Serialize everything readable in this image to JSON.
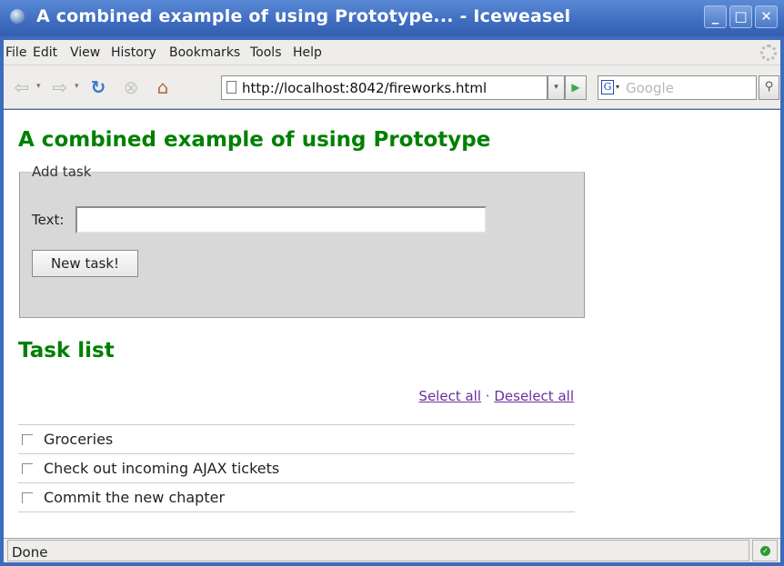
{
  "window": {
    "title": "A combined example of using Prototype... - Iceweasel",
    "controls": {
      "minimize": "_",
      "maximize": "□",
      "close": "✕"
    }
  },
  "menu": {
    "items": [
      {
        "label": "File"
      },
      {
        "label": "Edit"
      },
      {
        "label": "View"
      },
      {
        "label": "History"
      },
      {
        "label": "Bookmarks"
      },
      {
        "label": "Tools"
      },
      {
        "label": "Help"
      }
    ]
  },
  "navbar": {
    "url": "http://localhost:8042/fireworks.html",
    "search_placeholder": "Google",
    "icons": [
      "back-icon",
      "forward-icon",
      "reload-icon",
      "stop-icon",
      "home-icon",
      "page-icon",
      "go-icon",
      "google-icon",
      "search-icon"
    ]
  },
  "page": {
    "title": "A combined example of using Prototype",
    "add_task": {
      "legend": "Add task",
      "text_label": "Text:",
      "text_value": "",
      "button_label": "New task!"
    },
    "task_list": {
      "heading": "Task list",
      "select_all": "Select all",
      "separator": "·",
      "deselect_all": "Deselect all",
      "tasks": [
        {
          "label": "Groceries",
          "checked": false
        },
        {
          "label": "Check out incoming AJAX tickets",
          "checked": false
        },
        {
          "label": "Commit the new chapter",
          "checked": false
        }
      ]
    }
  },
  "status": {
    "text": "Done",
    "secure_icon": "secure-check-icon"
  },
  "colors": {
    "heading": "#008000",
    "link": "#6a2f9e",
    "titlebar": "#3e6cc0"
  }
}
